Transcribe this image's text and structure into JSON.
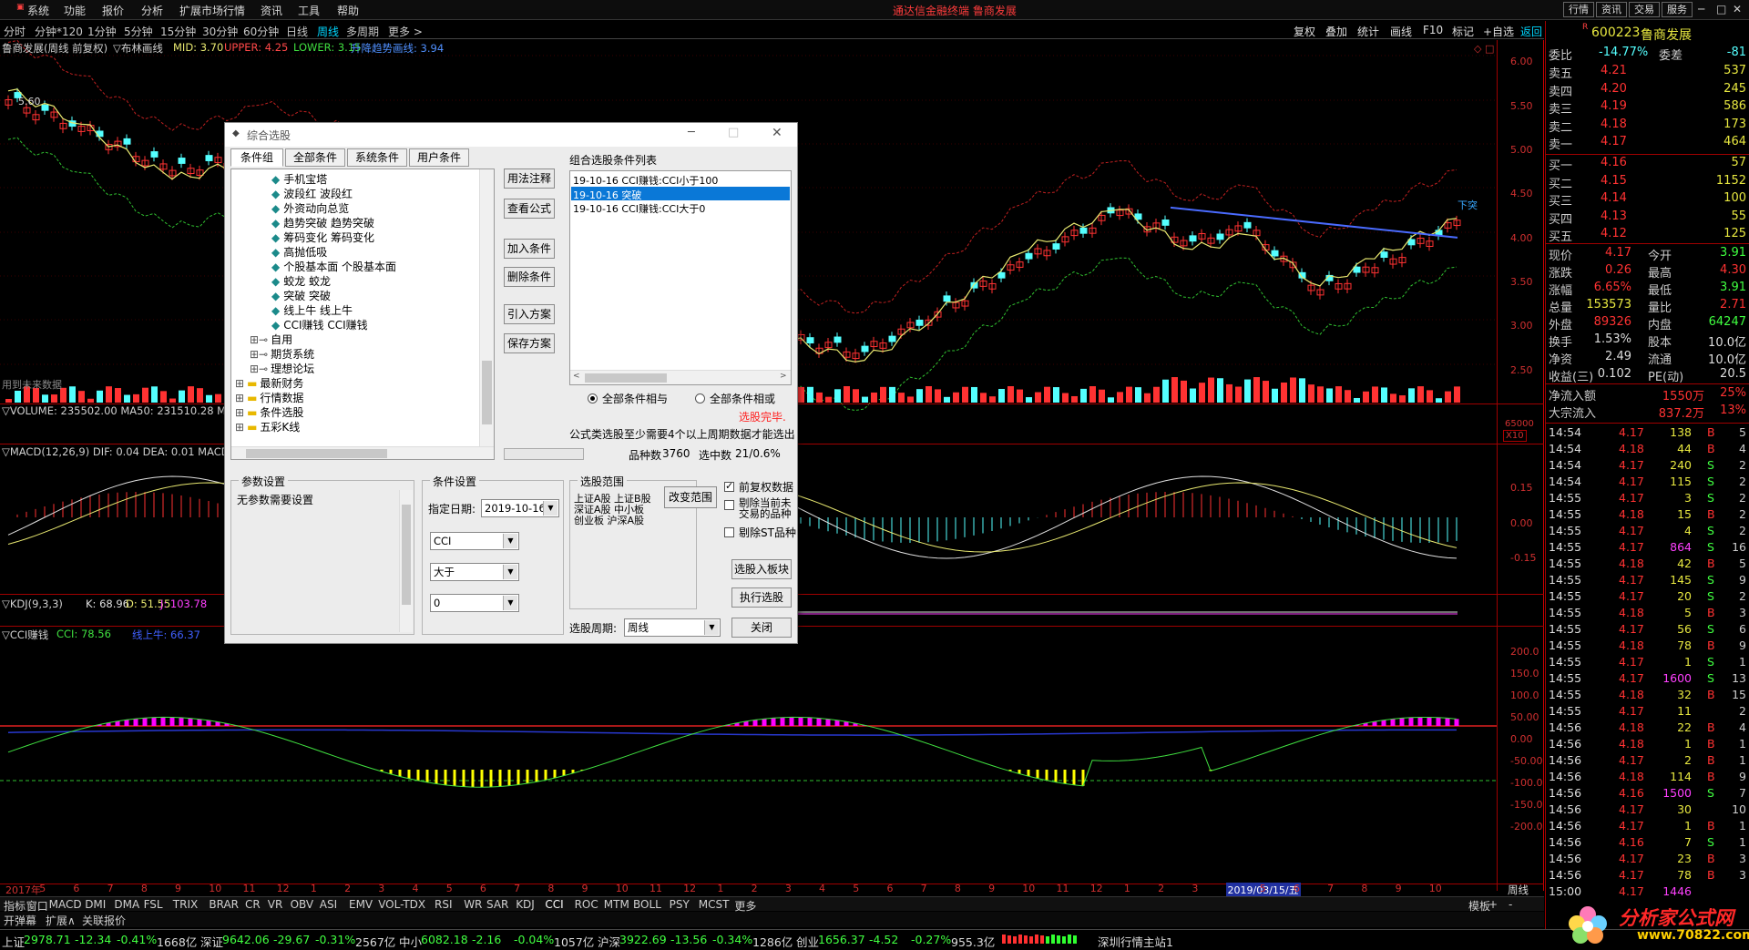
{
  "menubar": {
    "items": [
      "系统",
      "功能",
      "报价",
      "分析",
      "扩展市场行情",
      "资讯",
      "工具",
      "帮助"
    ],
    "title": "通达信金融终端  鲁商发展",
    "right_buttons": [
      "行情",
      "资讯",
      "交易",
      "服务"
    ]
  },
  "period_bar": {
    "items": [
      "分时",
      "分钟*120",
      "1分钟",
      "5分钟",
      "15分钟",
      "30分钟",
      "60分钟",
      "日线",
      "周线",
      "多周期",
      "更多 >"
    ],
    "selected": "周线",
    "right_items": [
      "复权",
      "叠加",
      "统计",
      "画线",
      "F10",
      "标记",
      "+自选",
      "返回"
    ]
  },
  "main_chart": {
    "title": "鲁商发展(周线 前复权)",
    "indicator": "▽布林画线",
    "mid": "MID: 3.70",
    "upper": "UPPER: 4.25",
    "lower": "LOWER: 3.15",
    "trend": "升降趋势画线: 3.94",
    "high_label": "5.60",
    "breakout_label": "下突",
    "future_label": "用到未来数据",
    "y_ticks": [
      "6.00",
      "5.50",
      "5.00",
      "4.50",
      "4.00",
      "3.50",
      "3.00",
      "2.50"
    ]
  },
  "volume_pane": {
    "label": "▽VOLUME: 235502.00  MA50: 231510.28  MA",
    "y_tick": "65000",
    "scale": "X10"
  },
  "macd_pane": {
    "label": "▽MACD(12,26,9)  DIF: 0.04  DEA: 0.01  MACD",
    "y_ticks": [
      "0.15",
      "0.00",
      "-0.15"
    ]
  },
  "kdj_pane": {
    "label_name": "▽KDJ(9,3,3)",
    "k": "K: 68.96",
    "d": "D: 51.55",
    "j": "J: 103.78"
  },
  "cci_pane": {
    "label_name": "▽CCI赚钱",
    "cci": "CCI: 78.56",
    "line": "线上牛: 66.37",
    "y_ticks": [
      "200.0",
      "150.0",
      "100.0",
      "50.00",
      "0.00",
      "-50.00",
      "-100.0",
      "-150.0",
      "-200.0"
    ]
  },
  "x_axis": {
    "labels": [
      "2017年",
      "5",
      "6",
      "7",
      "8",
      "9",
      "10",
      "11",
      "12",
      "1",
      "2",
      "3",
      "4",
      "5",
      "6",
      "7",
      "8",
      "9",
      "10",
      "11",
      "12",
      "1",
      "2",
      "3",
      "4",
      "5",
      "6",
      "7",
      "8",
      "9",
      "10",
      "11",
      "12",
      "1",
      "2",
      "3",
      "2019/03/15/五",
      "5",
      "6",
      "7",
      "8",
      "9",
      "10"
    ],
    "period": "周线"
  },
  "indicator_tabs": [
    "指标",
    "窗口",
    "MACD",
    "DMI",
    "DMA",
    "FSL",
    "TRIX",
    "BRAR",
    "CR",
    "VR",
    "OBV",
    "ASI",
    "EMV",
    "VOL-TDX",
    "RSI",
    "WR",
    "SAR",
    "KDJ",
    "CCI",
    "ROC",
    "MTM",
    "BOLL",
    "PSY",
    "MCST",
    "更多"
  ],
  "indicator_tabs_right": [
    "模板",
    "+",
    "-"
  ],
  "sub_tabs": [
    "开弹幕",
    "扩展∧",
    "关联报价"
  ],
  "quote_panel": {
    "code": "600223",
    "name": "鲁商发展",
    "weibi_label": "委比",
    "weibi": "-14.77%",
    "weicha_label": "委差",
    "weicha": "-81",
    "asks": [
      {
        "label": "卖五",
        "price": "4.21",
        "vol": "537"
      },
      {
        "label": "卖四",
        "price": "4.20",
        "vol": "245"
      },
      {
        "label": "卖三",
        "price": "4.19",
        "vol": "586"
      },
      {
        "label": "卖二",
        "price": "4.18",
        "vol": "173"
      },
      {
        "label": "卖一",
        "price": "4.17",
        "vol": "464"
      }
    ],
    "bids": [
      {
        "label": "买一",
        "price": "4.16",
        "vol": "57"
      },
      {
        "label": "买二",
        "price": "4.15",
        "vol": "1152"
      },
      {
        "label": "买三",
        "price": "4.14",
        "vol": "100"
      },
      {
        "label": "买四",
        "price": "4.13",
        "vol": "55"
      },
      {
        "label": "买五",
        "price": "4.12",
        "vol": "125"
      }
    ],
    "stats": [
      {
        "l1": "现价",
        "v1": "4.17",
        "l2": "今开",
        "v2": "3.91"
      },
      {
        "l1": "涨跌",
        "v1": "0.26",
        "l2": "最高",
        "v2": "4.30"
      },
      {
        "l1": "涨幅",
        "v1": "6.65%",
        "l2": "最低",
        "v2": "3.91"
      },
      {
        "l1": "总量",
        "v1": "153573",
        "l2": "量比",
        "v2": "2.71"
      },
      {
        "l1": "外盘",
        "v1": "89326",
        "l2": "内盘",
        "v2": "64247"
      },
      {
        "l1": "换手",
        "v1": "1.53%",
        "l2": "股本",
        "v2": "10.0亿"
      },
      {
        "l1": "净资",
        "v1": "2.49",
        "l2": "流通",
        "v2": "10.0亿"
      },
      {
        "l1": "收益(三)",
        "v1": "0.102",
        "l2": "PE(动)",
        "v2": "20.5"
      }
    ],
    "flows": [
      {
        "label": "净流入额",
        "value": "1550万",
        "pct": "25%"
      },
      {
        "label": "大宗流入",
        "value": "837.2万",
        "pct": "13%"
      }
    ],
    "ticks": [
      {
        "t": "14:54",
        "p": "4.17",
        "v": "138",
        "s": "B",
        "n": "5"
      },
      {
        "t": "14:54",
        "p": "4.18",
        "v": "44",
        "s": "B",
        "n": "4"
      },
      {
        "t": "14:54",
        "p": "4.17",
        "v": "240",
        "s": "S",
        "n": "2"
      },
      {
        "t": "14:54",
        "p": "4.17",
        "v": "115",
        "s": "S",
        "n": "2"
      },
      {
        "t": "14:55",
        "p": "4.17",
        "v": "3",
        "s": "S",
        "n": "2"
      },
      {
        "t": "14:55",
        "p": "4.18",
        "v": "15",
        "s": "B",
        "n": "2"
      },
      {
        "t": "14:55",
        "p": "4.17",
        "v": "4",
        "s": "S",
        "n": "2"
      },
      {
        "t": "14:55",
        "p": "4.17",
        "v": "864",
        "s": "S",
        "n": "16"
      },
      {
        "t": "14:55",
        "p": "4.18",
        "v": "42",
        "s": "B",
        "n": "5"
      },
      {
        "t": "14:55",
        "p": "4.17",
        "v": "145",
        "s": "S",
        "n": "9"
      },
      {
        "t": "14:55",
        "p": "4.17",
        "v": "20",
        "s": "S",
        "n": "2"
      },
      {
        "t": "14:55",
        "p": "4.18",
        "v": "5",
        "s": "B",
        "n": "3"
      },
      {
        "t": "14:55",
        "p": "4.17",
        "v": "56",
        "s": "S",
        "n": "6"
      },
      {
        "t": "14:55",
        "p": "4.18",
        "v": "78",
        "s": "B",
        "n": "9"
      },
      {
        "t": "14:55",
        "p": "4.17",
        "v": "1",
        "s": "S",
        "n": "1"
      },
      {
        "t": "14:55",
        "p": "4.17",
        "v": "1600",
        "s": "S",
        "n": "13"
      },
      {
        "t": "14:55",
        "p": "4.18",
        "v": "32",
        "s": "B",
        "n": "15"
      },
      {
        "t": "14:55",
        "p": "4.17",
        "v": "11",
        "s": "",
        "n": "2"
      },
      {
        "t": "14:56",
        "p": "4.18",
        "v": "22",
        "s": "B",
        "n": "4"
      },
      {
        "t": "14:56",
        "p": "4.18",
        "v": "1",
        "s": "B",
        "n": "1"
      },
      {
        "t": "14:56",
        "p": "4.17",
        "v": "2",
        "s": "B",
        "n": "1"
      },
      {
        "t": "14:56",
        "p": "4.18",
        "v": "114",
        "s": "B",
        "n": "9"
      },
      {
        "t": "14:56",
        "p": "4.16",
        "v": "1500",
        "s": "S",
        "n": "7"
      },
      {
        "t": "14:56",
        "p": "4.17",
        "v": "30",
        "s": "",
        "n": "10"
      },
      {
        "t": "14:56",
        "p": "4.17",
        "v": "1",
        "s": "B",
        "n": "1"
      },
      {
        "t": "14:56",
        "p": "4.16",
        "v": "7",
        "s": "S",
        "n": "1"
      },
      {
        "t": "14:56",
        "p": "4.17",
        "v": "23",
        "s": "B",
        "n": "3"
      },
      {
        "t": "14:56",
        "p": "4.17",
        "v": "78",
        "s": "B",
        "n": "3"
      },
      {
        "t": "15:00",
        "p": "4.17",
        "v": "1446",
        "s": "",
        "n": ""
      }
    ]
  },
  "statusbar": {
    "items": [
      {
        "name": "上证",
        "val": "2978.71",
        "chg": "-12.34",
        "pct": "-0.41%",
        "amt": "1668亿"
      },
      {
        "name": "深证",
        "val": "9642.06",
        "chg": "-29.67",
        "pct": "-0.31%",
        "amt": "2567亿"
      },
      {
        "name": "中小",
        "val": "6082.18",
        "chg": "-2.16",
        "pct": "-0.04%",
        "amt": "1057亿"
      },
      {
        "name": "沪深",
        "val": "3922.69",
        "chg": "-13.56",
        "pct": "-0.34%",
        "amt": "1286亿"
      },
      {
        "name": "创业",
        "val": "1656.37",
        "chg": "-4.52",
        "pct": "-0.27%",
        "amt": "955.3亿"
      }
    ],
    "site": "深圳行情主站1",
    "watermark_text": "分析家公式网",
    "watermark_url": "www.70822.com"
  },
  "dialog": {
    "title": "综合选股",
    "tabs": [
      "条件组",
      "全部条件",
      "系统条件",
      "用户条件"
    ],
    "tree_leaves": [
      "手机宝塔",
      "波段红  波段红",
      "外资动向总览",
      "趋势突破  趋势突破",
      "筹码变化  筹码变化",
      "高抛低吸",
      "个股基本面  个股基本面",
      "蛟龙  蛟龙",
      "突破  突破",
      "线上牛  线上牛",
      "CCI赚钱  CCI赚钱"
    ],
    "tree_groups_mid": [
      "自用",
      "期货系统",
      "理想论坛"
    ],
    "tree_groups_bottom": [
      "最新财务",
      "行情数据",
      "条件选股",
      "五彩K线"
    ],
    "mid_buttons": [
      "用法注释",
      "查看公式",
      "加入条件",
      "删除条件",
      "引入方案",
      "保存方案"
    ],
    "list_title": "组合选股条件列表",
    "list_items": [
      "19-10-16  CCI赚钱:CCI小于100",
      "19-10-16  突破",
      "19-10-16  CCI赚钱:CCI大于0"
    ],
    "radio_and": "全部条件相与",
    "radio_or": "全部条件相或",
    "done": "选股完毕.",
    "note": "公式类选股至少需要4个以上周期数据才能选出",
    "count_label": "品种数",
    "count": "3760",
    "selected_label": "选中数",
    "selected": "21/0.6%",
    "param_title": "参数设置",
    "param_text": "无参数需要设置",
    "cond_title": "条件设置",
    "date_label": "指定日期:",
    "date_value": "2019-10-16",
    "sel1": "CCI",
    "sel2": "大于",
    "sel3": "0",
    "range_title": "选股范围",
    "range_text1": "上证A股  上证B股",
    "range_text2": "深证A股  中小板",
    "range_text3": "创业板  沪深A股",
    "change_range": "改变范围",
    "chk1": "前复权数据",
    "chk2a": "剔除当前未",
    "chk2b": "交易的品种",
    "chk3": "剔除ST品种",
    "to_block": "选股入板块",
    "execute": "执行选股",
    "period_label": "选股周期:",
    "period_value": "周线",
    "close": "关闭"
  },
  "colors": {
    "up": "#ff3232",
    "down": "#54ffff",
    "pink": "#ff00ff",
    "yellow": "#ffff00",
    "trend": "#4a6bff"
  }
}
